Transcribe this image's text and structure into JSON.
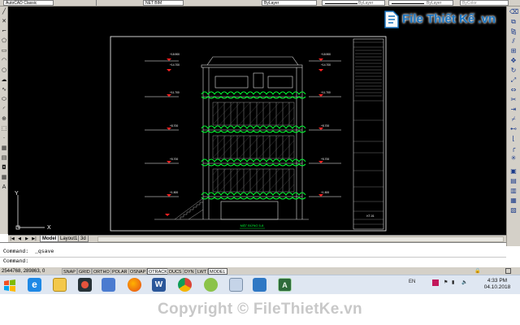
{
  "toolbar": {
    "workspace": "AutoCAD Classic",
    "dimstyle": "NET BIM",
    "color": "ByLayer",
    "linetype": "ByLayer",
    "lineweight": "ByLayer",
    "plotstyle": "ByColor"
  },
  "drawing": {
    "elevation_title": "MẶT ĐỨNG 5-8",
    "level_labels": [
      "+18.900",
      "+14.700",
      "+11.700",
      "+8.700",
      "+5.700",
      "+1.500",
      "±0.000"
    ],
    "title_block_sheet": "KT-01",
    "ucs_y": "Y",
    "ucs_x": "X",
    "colors": {
      "background": "#000000",
      "border": "#ffffff",
      "greenery": "#00ff33",
      "level_marker": "#ff2222",
      "structure": "#e0e0e0"
    }
  },
  "tabs": {
    "nav": [
      "|◀",
      "◀",
      "▶",
      "▶|"
    ],
    "items": [
      "Model",
      "Layout1",
      "3d"
    ],
    "active": "Model"
  },
  "command": {
    "history": "Command:  _qsave",
    "prompt": "Command:"
  },
  "status": {
    "coordinates": "2544768, 289863, 0",
    "buttons": [
      "SNAP",
      "GRID",
      "ORTHO",
      "POLAR",
      "OSNAP",
      "OTRACK",
      "DUCS",
      "DYN",
      "LWT",
      "MODEL"
    ],
    "on": [
      "OTRACK",
      "MODEL"
    ]
  },
  "taskbar": {
    "language": "EN",
    "time": "4:33 PM",
    "date": "04.10.2018",
    "apps": [
      "internet-explorer",
      "file-explorer",
      "media-player",
      "file-manager",
      "firefox",
      "word",
      "chrome",
      "app-green",
      "paint",
      "remote-desktop",
      "autocad"
    ]
  },
  "watermark": {
    "copyright": "Copyright © FileThietKe.vn",
    "logo": "File Thiết Kế .vn"
  }
}
